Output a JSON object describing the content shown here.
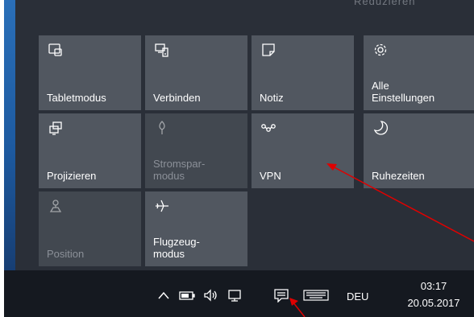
{
  "header": {
    "partial_text": "Reduzieren"
  },
  "tiles": [
    {
      "label": "Tabletmodus",
      "icon": "tablet-mode-icon",
      "state": "off"
    },
    {
      "label": "Verbinden",
      "icon": "connect-icon",
      "state": "off"
    },
    {
      "label": "Notiz",
      "icon": "note-icon",
      "state": "off"
    },
    {
      "label": "Alle\nEinstellungen",
      "icon": "settings-gear-icon",
      "state": "off"
    },
    {
      "label": "Projizieren",
      "icon": "project-icon",
      "state": "off"
    },
    {
      "label": "Stromspar-\nmodus",
      "icon": "battery-saver-icon",
      "state": "disabled"
    },
    {
      "label": "VPN",
      "icon": "vpn-icon",
      "state": "off"
    },
    {
      "label": "Ruhezeiten",
      "icon": "quiet-hours-moon-icon",
      "state": "off"
    },
    {
      "label": "Position",
      "icon": "location-icon",
      "state": "disabled"
    },
    {
      "label": "Flugzeug-\nmodus",
      "icon": "airplane-icon",
      "state": "off"
    }
  ],
  "taskbar": {
    "tray_icons": [
      "show-hidden-chevron-icon",
      "battery-icon",
      "volume-icon",
      "network-icon",
      "action-center-icon",
      "touch-keyboard-icon"
    ],
    "language": "DEU",
    "time": "03:17",
    "date": "20.05.2017"
  },
  "colors": {
    "panel": "#2a2f38",
    "tile": "#515760",
    "tile_disabled": "#424850",
    "taskbar": "#151920",
    "annotation_arrow": "#e00000"
  }
}
